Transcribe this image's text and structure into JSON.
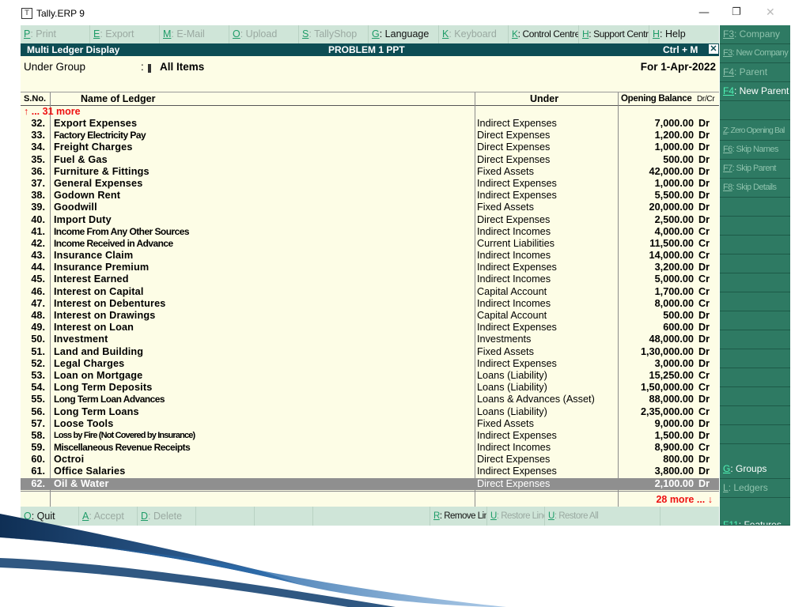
{
  "window": {
    "title": "Tally.ERP 9",
    "minimize_glyph": "—",
    "maximize_glyph": "❐",
    "close_glyph": "✕"
  },
  "top_buttons": [
    {
      "key": "P",
      "rest": ": Print",
      "enabled": false
    },
    {
      "key": "E",
      "rest": ": Export",
      "enabled": false
    },
    {
      "key": "M",
      "rest": ": E-Mail",
      "enabled": false
    },
    {
      "key": "O",
      "rest": ": Upload",
      "enabled": false
    },
    {
      "key": "S",
      "rest": ": TallyShop",
      "enabled": false
    },
    {
      "key": "G",
      "rest": ": Language",
      "enabled": true
    },
    {
      "key": "K",
      "rest": ": Keyboard",
      "enabled": false
    },
    {
      "key": "K",
      "rest": ": Control Centre",
      "enabled": true
    },
    {
      "key": "H",
      "rest": ": Support Centre",
      "enabled": true
    },
    {
      "key": "H",
      "rest": ": Help",
      "enabled": true
    }
  ],
  "header": {
    "title": "Multi Ledger  Display",
    "company": "PROBLEM 1 PPT",
    "shortcut": "Ctrl + M",
    "close_glyph": "✕"
  },
  "info": {
    "under_group_label": "Under Group",
    "colon": ":",
    "under_group_value": "All Items",
    "period": "For 1-Apr-2022"
  },
  "table": {
    "headers": {
      "sno": "S.No.",
      "name": "Name of Ledger",
      "under": "Under",
      "opening_balance": "Opening Balance",
      "drcr": "Dr/Cr"
    },
    "more_above": "↑ ... 31 more",
    "more_below": "28 more ... ↓",
    "selected_row": 62,
    "rows": [
      {
        "sno": "32.",
        "name": "Export Expenses",
        "under": "Indirect Expenses",
        "amount": "7,000.00",
        "drcr": "Dr"
      },
      {
        "sno": "33.",
        "name": "Factory Electricity Pay",
        "under": "Direct Expenses",
        "amount": "1,200.00",
        "drcr": "Dr"
      },
      {
        "sno": "34.",
        "name": "Freight Charges",
        "under": "Direct Expenses",
        "amount": "1,000.00",
        "drcr": "Dr"
      },
      {
        "sno": "35.",
        "name": "Fuel & Gas",
        "under": "Direct Expenses",
        "amount": "500.00",
        "drcr": "Dr"
      },
      {
        "sno": "36.",
        "name": "Furniture & Fittings",
        "under": "Fixed Assets",
        "amount": "42,000.00",
        "drcr": "Dr"
      },
      {
        "sno": "37.",
        "name": "General Expenses",
        "under": "Indirect Expenses",
        "amount": "1,000.00",
        "drcr": "Dr"
      },
      {
        "sno": "38.",
        "name": "Godown Rent",
        "under": "Indirect Expenses",
        "amount": "5,500.00",
        "drcr": "Dr"
      },
      {
        "sno": "39.",
        "name": "Goodwill",
        "under": "Fixed Assets",
        "amount": "20,000.00",
        "drcr": "Dr"
      },
      {
        "sno": "40.",
        "name": "Import Duty",
        "under": "Direct Expenses",
        "amount": "2,500.00",
        "drcr": "Dr"
      },
      {
        "sno": "41.",
        "name": "Income From Any Other Sources",
        "under": "Indirect Incomes",
        "amount": "4,000.00",
        "drcr": "Cr"
      },
      {
        "sno": "42.",
        "name": "Income Received in Advance",
        "under": "Current Liabilities",
        "amount": "11,500.00",
        "drcr": "Cr"
      },
      {
        "sno": "43.",
        "name": "Insurance Claim",
        "under": "Indirect Incomes",
        "amount": "14,000.00",
        "drcr": "Cr"
      },
      {
        "sno": "44.",
        "name": "Insurance Premium",
        "under": "Indirect Expenses",
        "amount": "3,200.00",
        "drcr": "Dr"
      },
      {
        "sno": "45.",
        "name": "Interest Earned",
        "under": "Indirect Incomes",
        "amount": "5,000.00",
        "drcr": "Cr"
      },
      {
        "sno": "46.",
        "name": "Interest on Capital",
        "under": "Capital Account",
        "amount": "1,700.00",
        "drcr": "Cr"
      },
      {
        "sno": "47.",
        "name": "Interest on Debentures",
        "under": "Indirect Incomes",
        "amount": "8,000.00",
        "drcr": "Cr"
      },
      {
        "sno": "48.",
        "name": "Interest on Drawings",
        "under": "Capital Account",
        "amount": "500.00",
        "drcr": "Dr"
      },
      {
        "sno": "49.",
        "name": "Interest on Loan",
        "under": "Indirect Expenses",
        "amount": "600.00",
        "drcr": "Dr"
      },
      {
        "sno": "50.",
        "name": "Investment",
        "under": "Investments",
        "amount": "48,000.00",
        "drcr": "Dr"
      },
      {
        "sno": "51.",
        "name": "Land and Building",
        "under": "Fixed Assets",
        "amount": "1,30,000.00",
        "drcr": "Dr"
      },
      {
        "sno": "52.",
        "name": "Legal Charges",
        "under": "Indirect Expenses",
        "amount": "3,000.00",
        "drcr": "Dr"
      },
      {
        "sno": "53.",
        "name": "Loan on Mortgage",
        "under": "Loans (Liability)",
        "amount": "15,250.00",
        "drcr": "Cr"
      },
      {
        "sno": "54.",
        "name": "Long Term Deposits",
        "under": "Loans (Liability)",
        "amount": "1,50,000.00",
        "drcr": "Cr"
      },
      {
        "sno": "55.",
        "name": "Long Term Loan Advances",
        "under": "Loans & Advances (Asset)",
        "amount": "88,000.00",
        "drcr": "Dr"
      },
      {
        "sno": "56.",
        "name": "Long Term Loans",
        "under": "Loans (Liability)",
        "amount": "2,35,000.00",
        "drcr": "Cr"
      },
      {
        "sno": "57.",
        "name": "Loose Tools",
        "under": "Fixed Assets",
        "amount": "9,000.00",
        "drcr": "Dr"
      },
      {
        "sno": "58.",
        "name": "Loss by Fire (Not Covered by Insurance)",
        "under": "Indirect Expenses",
        "amount": "1,500.00",
        "drcr": "Dr"
      },
      {
        "sno": "59.",
        "name": "Miscellaneous Revenue Receipts",
        "under": "Indirect Incomes",
        "amount": "8,900.00",
        "drcr": "Cr"
      },
      {
        "sno": "60.",
        "name": "Octroi",
        "under": "Direct Expenses",
        "amount": "800.00",
        "drcr": "Dr"
      },
      {
        "sno": "61.",
        "name": "Office Salaries",
        "under": "Indirect Expenses",
        "amount": "3,800.00",
        "drcr": "Dr"
      },
      {
        "sno": "62.",
        "name": "Oil & Water",
        "under": "Direct Expenses",
        "amount": "2,100.00",
        "drcr": "Dr"
      }
    ]
  },
  "bottom_buttons": [
    {
      "key": "Q",
      "rest": ": Quit",
      "enabled": true
    },
    {
      "key": "A",
      "rest": ": Accept",
      "enabled": false
    },
    {
      "key": "D",
      "rest": ": Delete",
      "enabled": false
    },
    {
      "key": "",
      "rest": "",
      "enabled": false
    },
    {
      "key": "",
      "rest": "",
      "enabled": false
    },
    {
      "key": "",
      "rest": "",
      "enabled": false
    },
    {
      "key": "R",
      "rest": ": Remove Line",
      "enabled": true
    },
    {
      "key": "U",
      "rest": ": Restore Line",
      "enabled": false
    },
    {
      "key": "U",
      "rest": ": Restore All",
      "enabled": false
    },
    {
      "key": "",
      "rest": "",
      "enabled": false
    }
  ],
  "right_panel": [
    {
      "key": "F3",
      "rest": ": Company",
      "enabled": false
    },
    {
      "key": "F3",
      "rest": ": New Company",
      "enabled": false
    },
    {
      "key": "F4",
      "rest": ": Parent",
      "enabled": false
    },
    {
      "key": "F4",
      "rest": ": New Parent",
      "enabled": true
    },
    {
      "key": "",
      "rest": "",
      "enabled": false
    },
    {
      "key": "Z",
      "rest": ": Zero Opening Bal",
      "enabled": false
    },
    {
      "key": "F6",
      "rest": ": Skip Names",
      "enabled": false
    },
    {
      "key": "F7",
      "rest": ": Skip Parent",
      "enabled": false
    },
    {
      "key": "F8",
      "rest": ": Skip Details",
      "enabled": false
    },
    {
      "key": "G",
      "rest": ": Groups",
      "enabled": true
    },
    {
      "key": "L",
      "rest": ": Ledgers",
      "enabled": false
    },
    {
      "key": "F11",
      "rest": ": Features",
      "enabled": true
    }
  ],
  "colors": {
    "header_bg": "#0d4d54",
    "button_bar_bg": "#cfe5d8",
    "right_panel_bg": "#2e7a63",
    "table_bg": "#fdfde6",
    "hotkey_green": "#1f9c68",
    "more_red": "#e11111",
    "selected_row_bg": "#8f8f8f"
  }
}
